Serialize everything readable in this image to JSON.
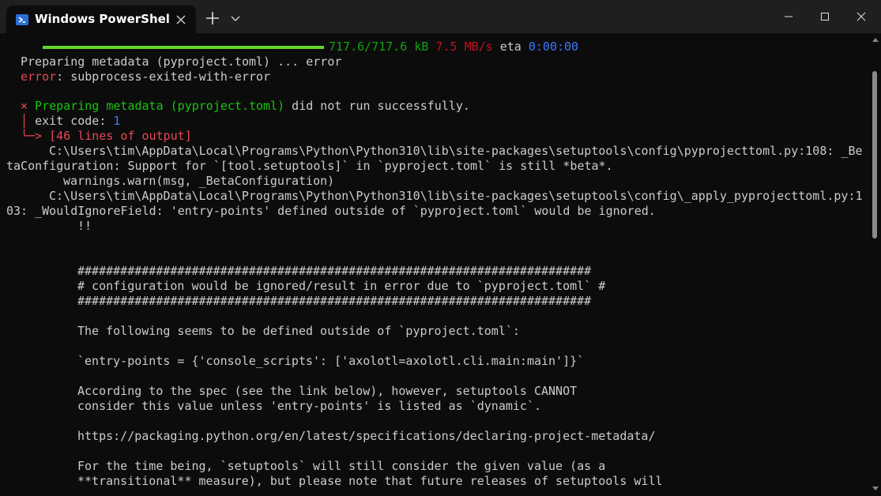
{
  "window": {
    "tab_title": "Windows PowerShel",
    "colors": {
      "titlebar": "#1f1f1f",
      "background": "#0c0c0c",
      "text": "#cccccc"
    }
  },
  "terminal": {
    "progress": {
      "fraction": 1.0,
      "size": "717.6/717.6 kB",
      "speed": "7.5 MB/s",
      "eta_label": "eta",
      "eta_value": "0:00:00"
    },
    "line_preparing": "Preparing metadata (pyproject.toml) ... error",
    "error_label": "error",
    "error_text": ": subprocess-exited-with-error",
    "failure_mark": "×",
    "failure_text": " Preparing metadata (pyproject.toml)",
    "failure_rest": " did not run successfully.",
    "exit_code_label": "exit code: ",
    "exit_code_value": "1",
    "output_lines": "> [46 lines of output]",
    "warn1_a": "C:\\Users\\tim\\AppData\\Local\\Programs\\Python\\Python310\\lib\\site-packages\\setuptools\\config\\pyprojecttoml.py:108: _Be",
    "warn1_b": "taConfiguration: Support for `[tool.setuptools]` in `pyproject.toml` is still *beta*.",
    "warn1_c": "warnings.warn(msg, _BetaConfiguration)",
    "warn2_a": "C:\\Users\\tim\\AppData\\Local\\Programs\\Python\\Python310\\lib\\site-packages\\setuptools\\config\\_apply_pyprojecttoml.py:1",
    "warn2_b": "03: _WouldIgnoreField: 'entry-points' defined outside of `pyproject.toml` would be ignored.",
    "bangs": "!!",
    "hash_line": "########################################################################",
    "config_line": "# configuration would be ignored/result in error due to `pyproject.toml` #",
    "following": "The following seems to be defined outside of `pyproject.toml`:",
    "entry_points": "`entry-points = {'console_scripts': ['axolotl=axolotl.cli.main:main']}`",
    "spec1": "According to the spec (see the link below), however, setuptools CANNOT",
    "spec2": "consider this value unless 'entry-points' is listed as `dynamic`.",
    "url": "https://packaging.python.org/en/latest/specifications/declaring-project-metadata/",
    "time1": "For the time being, `setuptools` will still consider the given value (as a",
    "time2": "**transitional** measure), but please note that future releases of setuptools will"
  },
  "icons": {
    "tab": "powershell-icon",
    "close": "close-icon",
    "new_tab": "plus-icon",
    "dropdown": "chevron-down-icon",
    "minimize": "minimize-icon",
    "maximize": "maximize-icon",
    "window_close": "window-close-icon"
  }
}
